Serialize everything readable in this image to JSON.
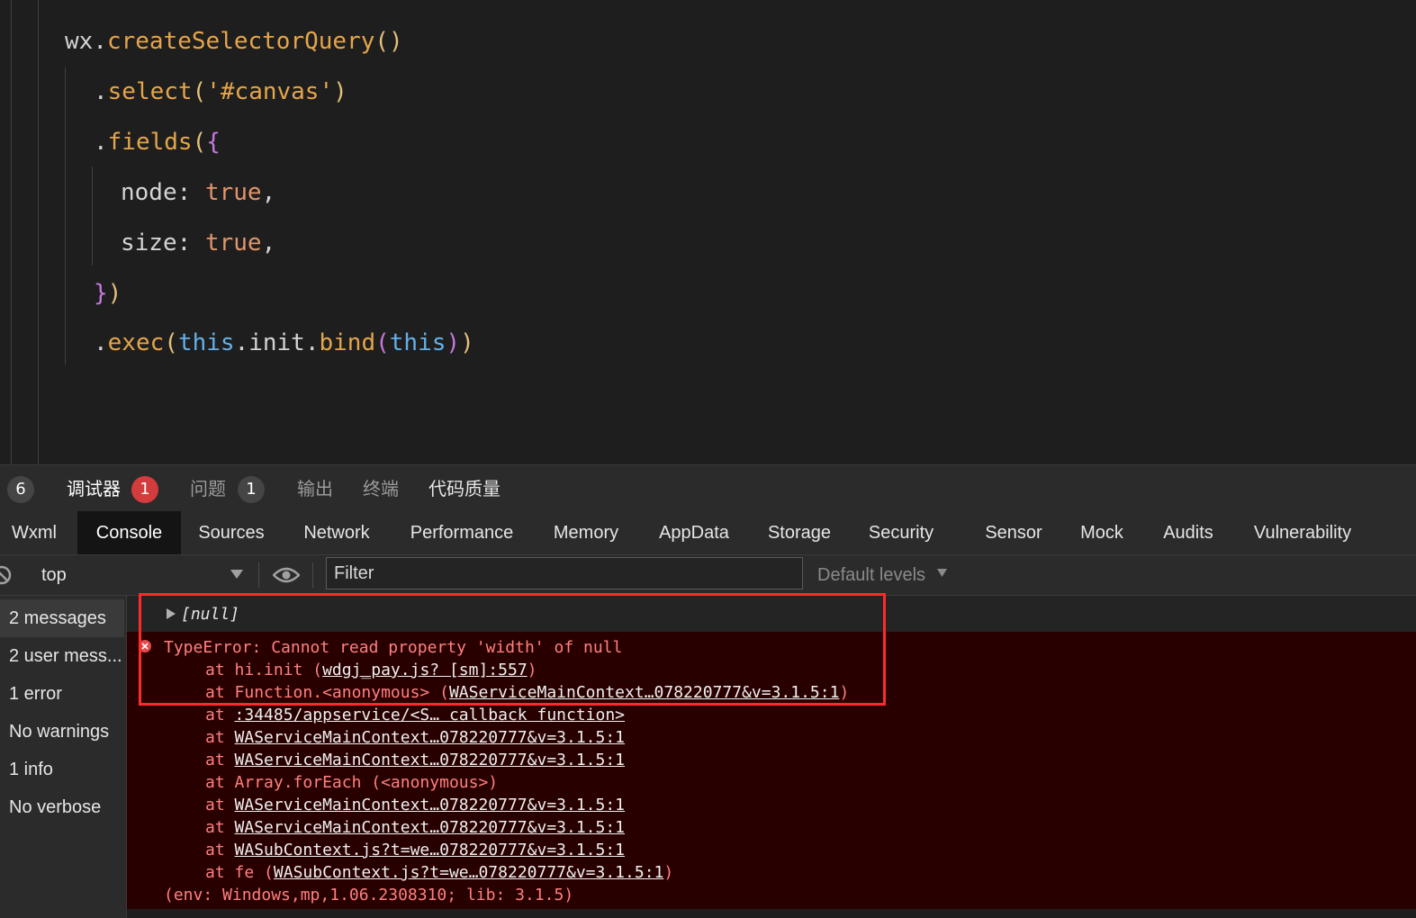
{
  "editor": {
    "lines": {
      "l1": {
        "obj": "wx",
        "dot": ".",
        "fn": "createSelectorQuery",
        "paren": "()"
      },
      "l2": {
        "dot": ".",
        "fn": "select",
        "open": "(",
        "str": "'#canvas'",
        "close": ")"
      },
      "l3": {
        "dot": ".",
        "fn": "fields",
        "open": "(",
        "brace": "{"
      },
      "l4": {
        "key": "node",
        "colon": ": ",
        "val": "true",
        "comma": ","
      },
      "l5": {
        "key": "size",
        "colon": ": ",
        "val": "true",
        "comma": ","
      },
      "l6": {
        "brace": "}",
        "close": ")"
      },
      "l7": {
        "dot": ".",
        "fn": "exec",
        "open": "(",
        "this1": "this",
        "dot2": ".",
        "init": "init",
        "dot3": ".",
        "bind": "bind",
        "open2": "(",
        "this2": "this",
        "close2": ")",
        "close": ")"
      }
    }
  },
  "panel_tabs": {
    "count_badge": "6",
    "debugger": "调试器",
    "debugger_badge": "1",
    "issues": "问题",
    "issues_badge": "1",
    "output": "输出",
    "terminal": "终端",
    "code_quality": "代码质量"
  },
  "dev_tabs": [
    "Wxml",
    "Console",
    "Sources",
    "Network",
    "Performance",
    "Memory",
    "AppData",
    "Storage",
    "Security",
    "Sensor",
    "Mock",
    "Audits",
    "Vulnerability"
  ],
  "toolbar": {
    "context": "top",
    "filter": "Filter",
    "levels": "Default levels"
  },
  "sidebar": [
    "2 messages",
    "2 user mess...",
    "1 error",
    "No warnings",
    "1 info",
    "No verbose"
  ],
  "console": {
    "null_entry": "[null]",
    "error_message": "TypeError: Cannot read property 'width' of null",
    "at": "at",
    "frames": {
      "f1_prefix": "hi.init (",
      "f1_link": "wdgj_pay.js? [sm]:557",
      "f1_suffix": ")",
      "f2_prefix": "Function.<anonymous> (",
      "f2_link": "WAServiceMainContext…078220777&v=3.1.5:1",
      "f2_suffix": ")",
      "f3_link": ":34485/appservice/<S… callback function>",
      "f4_link": "WAServiceMainContext…078220777&v=3.1.5:1",
      "f5_link": "WAServiceMainContext…078220777&v=3.1.5:1",
      "f6_text": "Array.forEach (<anonymous>)",
      "f7_link": "WAServiceMainContext…078220777&v=3.1.5:1",
      "f8_link": "WAServiceMainContext…078220777&v=3.1.5:1",
      "f9_link": "WASubContext.js?t=we…078220777&v=3.1.5:1",
      "f10_prefix": "fe (",
      "f10_link": "WASubContext.js?t=we…078220777&v=3.1.5:1",
      "f10_suffix": ")"
    },
    "env": "(env: Windows,mp,1.06.2308310; lib: 3.1.5)"
  },
  "colors": {
    "highlight": "#ff2b2b",
    "badge": "#d23c3c",
    "error_bg": "#290000"
  }
}
